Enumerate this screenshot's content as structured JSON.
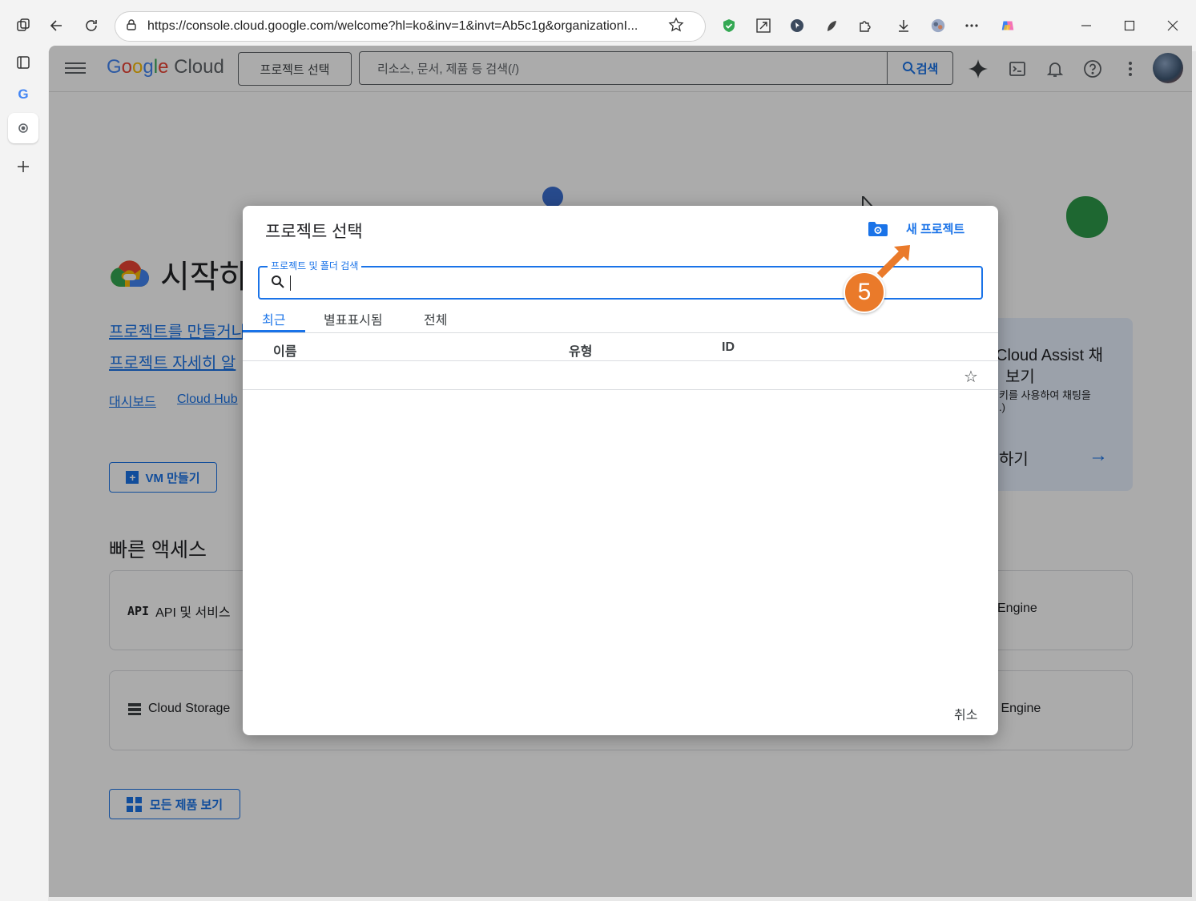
{
  "browser": {
    "url": "https://console.cloud.google.com/welcome?hl=ko&inv=1&invt=Ab5c1g&organizationI..."
  },
  "header": {
    "logo_google": [
      "G",
      "o",
      "o",
      "g",
      "l",
      "e"
    ],
    "logo_cloud": "Cloud",
    "project_button": "프로젝트 선택",
    "search_placeholder": "리소스, 문서, 제품 등 검색(/)",
    "search_button": "검색"
  },
  "background": {
    "title": "시작하",
    "link1": "프로젝트를 만들거나",
    "link2": "프로젝트 자세히 알",
    "nav_dashboard": "대시보드",
    "nav_cloudhub": "Cloud Hub",
    "vm_button": "VM 만들기",
    "quick_access_title": "빠른 액세스",
    "qa_api": "API 및 서비스",
    "qa_api_prefix": "API",
    "qa_storage": "Cloud Storage",
    "qa_right1": "Engine",
    "qa_right2": "s Engine",
    "assist_title1": "Cloud Assist 채",
    "assist_title2": "보기",
    "assist_desc1": "키를 사용하여 채팅을",
    "assist_desc2": ".)",
    "assist_action": "하기",
    "all_products": "모든 제품 보기"
  },
  "dialog": {
    "title": "프로젝트 선택",
    "new_project": "새 프로젝트",
    "search_label": "프로젝트 및 폴더 검색",
    "tabs": [
      "최근",
      "별표표시됨",
      "전체"
    ],
    "columns": [
      "이름",
      "유형",
      "ID"
    ],
    "cancel": "취소"
  },
  "annotation": {
    "step_number": "5",
    "color": "#ea7a2a"
  },
  "colors": {
    "accent": "#1a73e8"
  }
}
